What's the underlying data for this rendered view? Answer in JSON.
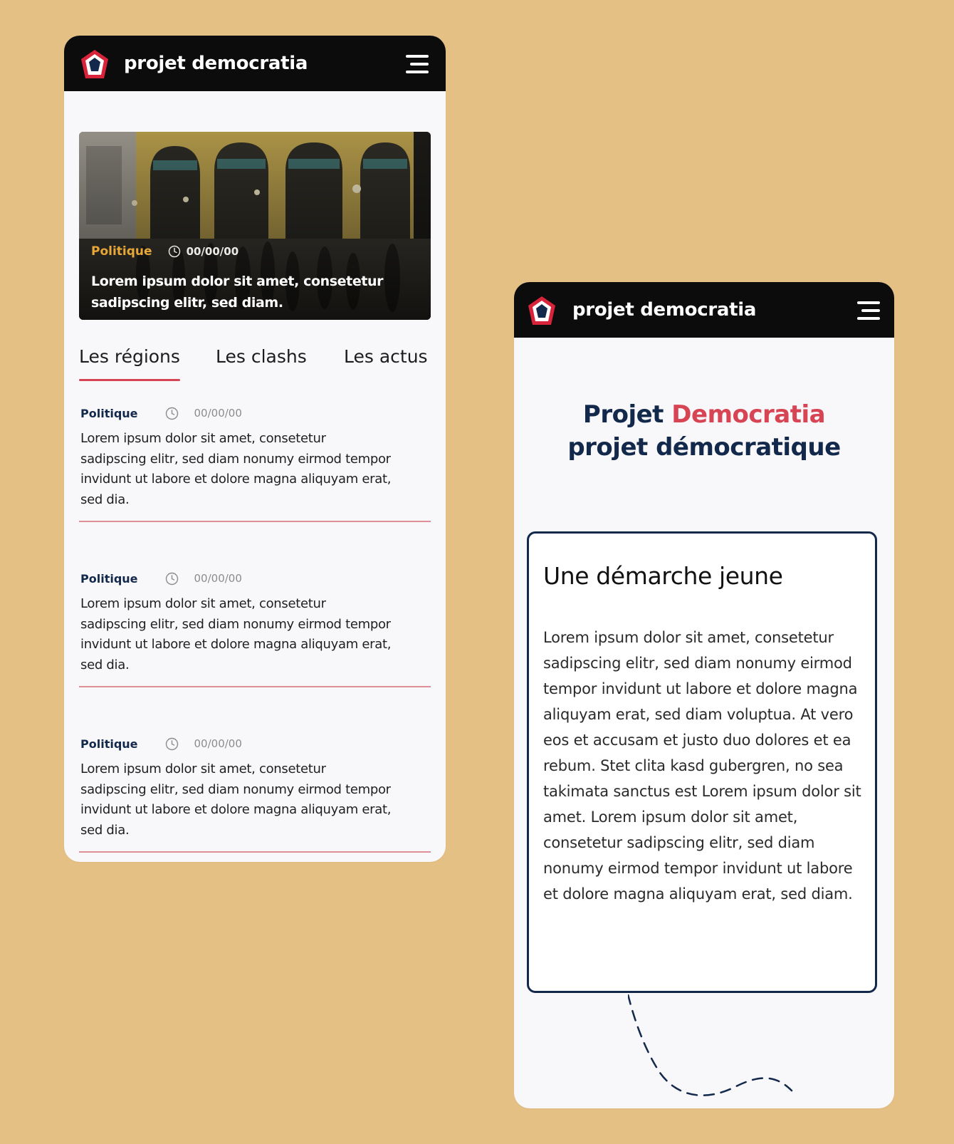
{
  "colors": {
    "background": "#e5c085",
    "navy": "#13294b",
    "red": "#d74453",
    "gold": "#e7a837",
    "topbar": "#0c0c0d"
  },
  "left_screen": {
    "header": {
      "brand": "projet democratia",
      "logo_icon": "pentagon-logo-icon",
      "menu_icon": "hamburger-menu-icon"
    },
    "hero": {
      "category": "Politique",
      "date": "00/00/00",
      "title": "Lorem ipsum dolor sit amet, consetetur sadipscing elitr, sed diam."
    },
    "tabs": [
      {
        "label": "Les régions",
        "active": true
      },
      {
        "label": "Les clashs",
        "active": false
      },
      {
        "label": "Les actus",
        "active": false
      }
    ],
    "articles": [
      {
        "category": "Politique",
        "date": "00/00/00",
        "text": "Lorem ipsum dolor sit amet, consetetur sadipscing elitr, sed diam nonumy eirmod tempor invidunt ut labore et dolore magna aliquyam erat, sed dia."
      },
      {
        "category": "Politique",
        "date": "00/00/00",
        "text": "Lorem ipsum dolor sit amet, consetetur sadipscing elitr, sed diam nonumy eirmod tempor invidunt ut labore et dolore magna aliquyam erat, sed dia."
      },
      {
        "category": "Politique",
        "date": "00/00/00",
        "text": "Lorem ipsum dolor sit amet, consetetur sadipscing elitr, sed diam nonumy eirmod tempor invidunt ut labore et dolore magna aliquyam erat, sed dia."
      }
    ]
  },
  "right_screen": {
    "header": {
      "brand": "projet democratia",
      "logo_icon": "pentagon-logo-icon",
      "menu_icon": "hamburger-menu-icon"
    },
    "heading": {
      "line1_part1": "Projet",
      "line1_part2": "Democratia",
      "line2": "projet démocratique"
    },
    "card": {
      "title": "Une démarche jeune",
      "body": "Lorem ipsum dolor sit amet, consetetur sadipscing elitr, sed diam nonumy eirmod tempor invidunt ut labore et dolore magna aliquyam erat, sed diam voluptua. At vero eos et accusam et justo duo dolores et ea rebum. Stet clita kasd gubergren, no sea takimata sanctus est Lorem ipsum dolor sit amet. Lorem ipsum dolor sit amet, consetetur sadipscing elitr, sed diam nonumy eirmod tempor invidunt ut labore et dolore magna aliquyam erat, sed diam."
    }
  }
}
